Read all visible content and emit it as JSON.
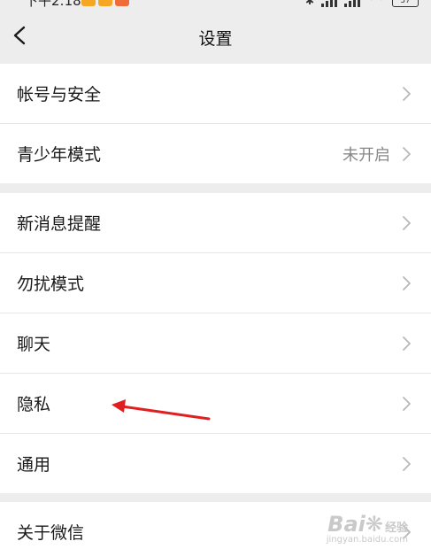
{
  "status_bar": {
    "time": "下午2:18",
    "app_icon_colors": [
      "#f5a623",
      "#f5a623",
      "#ef6c3a"
    ],
    "more": "···",
    "battery": "37"
  },
  "nav": {
    "title": "设置",
    "back_icon": "chevron-left-icon"
  },
  "groups": [
    {
      "items": [
        {
          "label": "帐号与安全",
          "value": ""
        },
        {
          "label": "青少年模式",
          "value": "未开启"
        }
      ]
    },
    {
      "items": [
        {
          "label": "新消息提醒",
          "value": ""
        },
        {
          "label": "勿扰模式",
          "value": ""
        },
        {
          "label": "聊天",
          "value": ""
        },
        {
          "label": "隐私",
          "value": ""
        },
        {
          "label": "通用",
          "value": ""
        }
      ]
    },
    {
      "items": [
        {
          "label": "关于微信",
          "value": ""
        }
      ]
    }
  ],
  "annotation": {
    "type": "red-arrow",
    "color": "#e02020",
    "points_to": "隐私"
  },
  "watermark": {
    "brand": "Bai",
    "brand_suffix": "经验",
    "url": "jingyan.baidu.com"
  },
  "colors": {
    "background": "#ededed",
    "row_background": "#ffffff",
    "divider": "#e6e6e6",
    "chevron": "#b8b8b8"
  }
}
